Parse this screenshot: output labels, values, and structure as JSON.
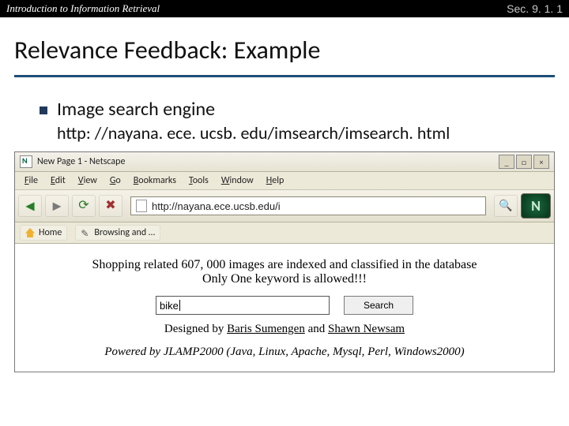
{
  "header": {
    "left": "Introduction to Information Retrieval",
    "right": "Sec. 9. 1. 1"
  },
  "slide": {
    "title": "Relevance Feedback: Example",
    "bullet": "Image search engine",
    "url_text": "http: //nayana. ece. ucsb. edu/imsearch/imsearch. html"
  },
  "browser": {
    "window_title": "New Page 1 - Netscape",
    "menu": {
      "file": "File",
      "edit": "Edit",
      "view": "View",
      "go": "Go",
      "bookmarks": "Bookmarks",
      "tools": "Tools",
      "window": "Window",
      "help": "Help"
    },
    "address": "http://nayana.ece.ucsb.edu/i",
    "bookmarks_bar": {
      "home": "Home",
      "browsing": "Browsing and …"
    },
    "logo_letter": "N"
  },
  "page": {
    "line1": "Shopping related 607, 000 images are indexed and classified in the database",
    "line2": "Only One keyword is allowed!!!",
    "search_value": "bike",
    "search_button": "Search",
    "designed_prefix": "Designed by ",
    "author1": "Baris Sumengen",
    "and": " and ",
    "author2": "Shawn Newsam",
    "powered": "Powered by JLAMP2000 (Java, Linux, Apache, Mysql, Perl, Windows2000)"
  },
  "win_btns": {
    "min": "_",
    "max": "□",
    "close": "×"
  }
}
